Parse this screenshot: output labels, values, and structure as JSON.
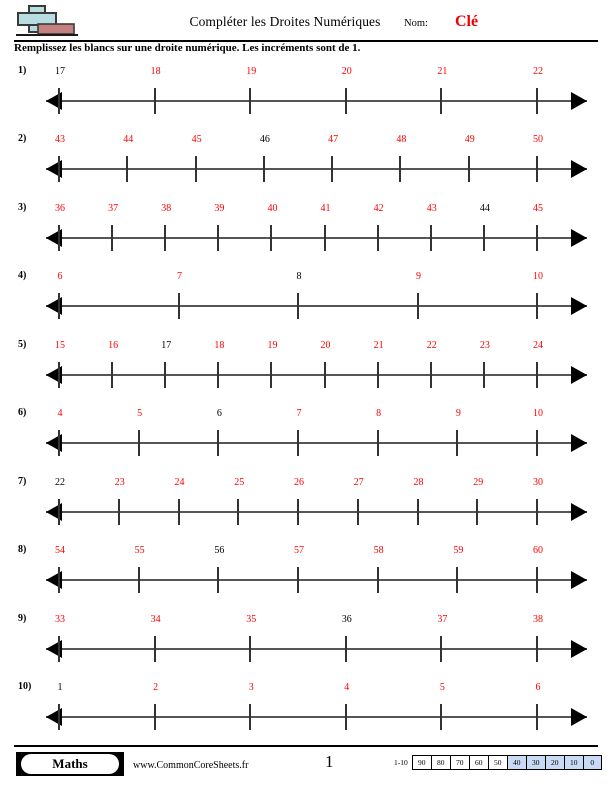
{
  "header": {
    "title": "Compléter les Droites Numériques",
    "name_label": "Nom:",
    "name_value": "Clé",
    "instructions": "Remplissez les blancs sur une droite numérique. Les incréments sont de 1.",
    "logo_icon": "plus-block-logo"
  },
  "problems": [
    {
      "num": "1)",
      "ticks": [
        {
          "label": "17",
          "color": "black"
        },
        {
          "label": "18",
          "color": "red"
        },
        {
          "label": "19",
          "color": "red"
        },
        {
          "label": "20",
          "color": "red"
        },
        {
          "label": "21",
          "color": "red"
        },
        {
          "label": "22",
          "color": "red"
        }
      ]
    },
    {
      "num": "2)",
      "ticks": [
        {
          "label": "43",
          "color": "red"
        },
        {
          "label": "44",
          "color": "red"
        },
        {
          "label": "45",
          "color": "red"
        },
        {
          "label": "46",
          "color": "black"
        },
        {
          "label": "47",
          "color": "red"
        },
        {
          "label": "48",
          "color": "red"
        },
        {
          "label": "49",
          "color": "red"
        },
        {
          "label": "50",
          "color": "red"
        }
      ]
    },
    {
      "num": "3)",
      "ticks": [
        {
          "label": "36",
          "color": "red"
        },
        {
          "label": "37",
          "color": "red"
        },
        {
          "label": "38",
          "color": "red"
        },
        {
          "label": "39",
          "color": "red"
        },
        {
          "label": "40",
          "color": "red"
        },
        {
          "label": "41",
          "color": "red"
        },
        {
          "label": "42",
          "color": "red"
        },
        {
          "label": "43",
          "color": "red"
        },
        {
          "label": "44",
          "color": "black"
        },
        {
          "label": "45",
          "color": "red"
        }
      ]
    },
    {
      "num": "4)",
      "ticks": [
        {
          "label": "6",
          "color": "red"
        },
        {
          "label": "7",
          "color": "red"
        },
        {
          "label": "8",
          "color": "black"
        },
        {
          "label": "9",
          "color": "red"
        },
        {
          "label": "10",
          "color": "red"
        }
      ]
    },
    {
      "num": "5)",
      "ticks": [
        {
          "label": "15",
          "color": "red"
        },
        {
          "label": "16",
          "color": "red"
        },
        {
          "label": "17",
          "color": "black"
        },
        {
          "label": "18",
          "color": "red"
        },
        {
          "label": "19",
          "color": "red"
        },
        {
          "label": "20",
          "color": "red"
        },
        {
          "label": "21",
          "color": "red"
        },
        {
          "label": "22",
          "color": "red"
        },
        {
          "label": "23",
          "color": "red"
        },
        {
          "label": "24",
          "color": "red"
        }
      ]
    },
    {
      "num": "6)",
      "ticks": [
        {
          "label": "4",
          "color": "red"
        },
        {
          "label": "5",
          "color": "red"
        },
        {
          "label": "6",
          "color": "black"
        },
        {
          "label": "7",
          "color": "red"
        },
        {
          "label": "8",
          "color": "red"
        },
        {
          "label": "9",
          "color": "red"
        },
        {
          "label": "10",
          "color": "red"
        }
      ]
    },
    {
      "num": "7)",
      "ticks": [
        {
          "label": "22",
          "color": "black"
        },
        {
          "label": "23",
          "color": "red"
        },
        {
          "label": "24",
          "color": "red"
        },
        {
          "label": "25",
          "color": "red"
        },
        {
          "label": "26",
          "color": "red"
        },
        {
          "label": "27",
          "color": "red"
        },
        {
          "label": "28",
          "color": "red"
        },
        {
          "label": "29",
          "color": "red"
        },
        {
          "label": "30",
          "color": "red"
        }
      ]
    },
    {
      "num": "8)",
      "ticks": [
        {
          "label": "54",
          "color": "red"
        },
        {
          "label": "55",
          "color": "red"
        },
        {
          "label": "56",
          "color": "black"
        },
        {
          "label": "57",
          "color": "red"
        },
        {
          "label": "58",
          "color": "red"
        },
        {
          "label": "59",
          "color": "red"
        },
        {
          "label": "60",
          "color": "red"
        }
      ]
    },
    {
      "num": "9)",
      "ticks": [
        {
          "label": "33",
          "color": "red"
        },
        {
          "label": "34",
          "color": "red"
        },
        {
          "label": "35",
          "color": "red"
        },
        {
          "label": "36",
          "color": "black"
        },
        {
          "label": "37",
          "color": "red"
        },
        {
          "label": "38",
          "color": "red"
        }
      ]
    },
    {
      "num": "10)",
      "ticks": [
        {
          "label": "1",
          "color": "black"
        },
        {
          "label": "2",
          "color": "red"
        },
        {
          "label": "3",
          "color": "red"
        },
        {
          "label": "4",
          "color": "red"
        },
        {
          "label": "5",
          "color": "red"
        },
        {
          "label": "6",
          "color": "red"
        }
      ]
    }
  ],
  "footer": {
    "brand": "Maths",
    "url": "www.CommonCoreSheets.fr",
    "page_number": "1",
    "score_range": "1-10",
    "score_cells": [
      {
        "label": "90",
        "filled": false
      },
      {
        "label": "80",
        "filled": false
      },
      {
        "label": "70",
        "filled": false
      },
      {
        "label": "60",
        "filled": false
      },
      {
        "label": "50",
        "filled": false
      },
      {
        "label": "40",
        "filled": true
      },
      {
        "label": "30",
        "filled": true
      },
      {
        "label": "20",
        "filled": true
      },
      {
        "label": "10",
        "filled": true
      },
      {
        "label": "0",
        "filled": true
      }
    ]
  },
  "colors": {
    "answer_red": "#ff0000",
    "score_fill": "#c9daf4",
    "axis_gray": "#555555"
  }
}
